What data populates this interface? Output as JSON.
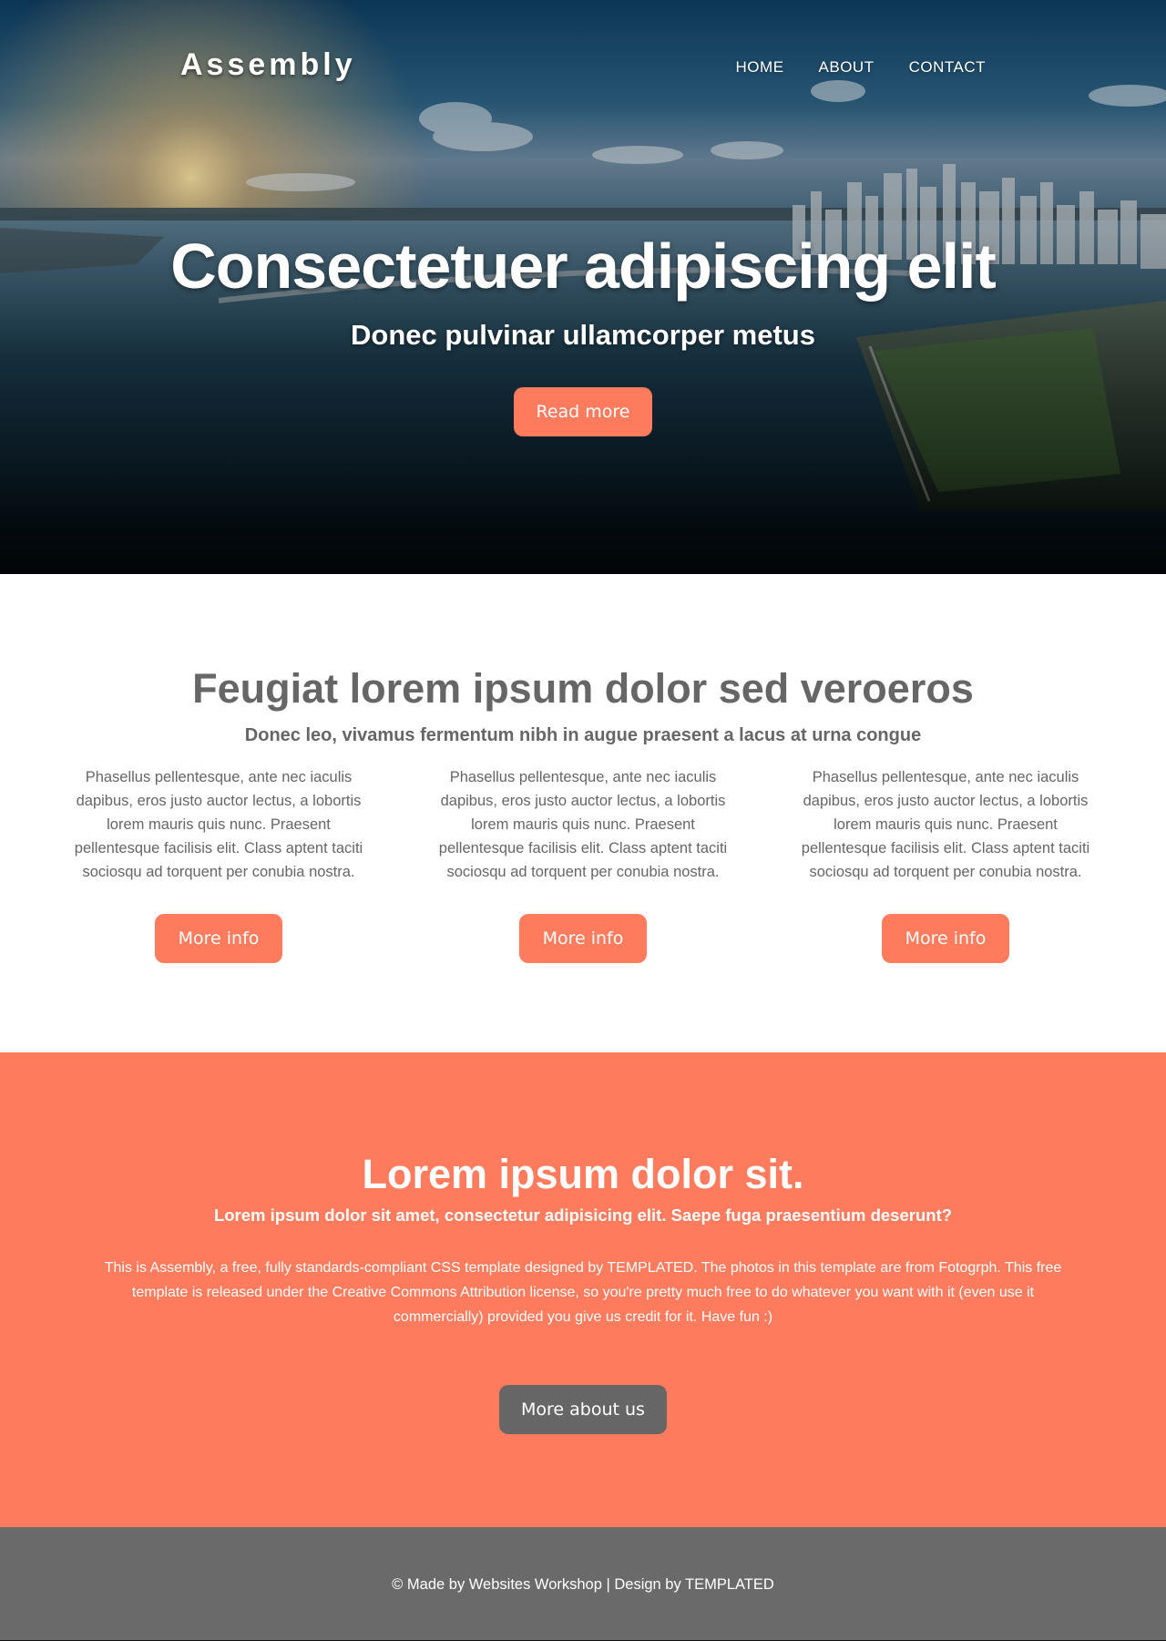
{
  "header": {
    "logo": "Assembly",
    "nav": [
      {
        "label": "HOME"
      },
      {
        "label": "ABOUT"
      },
      {
        "label": "CONTACT"
      }
    ]
  },
  "hero": {
    "title": "Consectetuer adipiscing elit",
    "subtitle": "Donec pulvinar ullamcorper metus",
    "button": "Read more"
  },
  "features": {
    "title": "Feugiat lorem ipsum dolor sed veroeros",
    "subtitle": "Donec leo, vivamus fermentum nibh in augue praesent a lacus at urna congue",
    "columns": [
      {
        "text": "Phasellus pellentesque, ante nec iaculis dapibus, eros justo auctor lectus, a lobortis lorem mauris quis nunc. Praesent pellentesque facilisis elit. Class aptent taciti sociosqu ad torquent per conubia nostra.",
        "button": "More info"
      },
      {
        "text": "Phasellus pellentesque, ante nec iaculis dapibus, eros justo auctor lectus, a lobortis lorem mauris quis nunc. Praesent pellentesque facilisis elit. Class aptent taciti sociosqu ad torquent per conubia nostra.",
        "button": "More info"
      },
      {
        "text": "Phasellus pellentesque, ante nec iaculis dapibus, eros justo auctor lectus, a lobortis lorem mauris quis nunc. Praesent pellentesque facilisis elit. Class aptent taciti sociosqu ad torquent per conubia nostra.",
        "button": "More info"
      }
    ]
  },
  "about": {
    "title": "Lorem ipsum dolor sit.",
    "subtitle": "Lorem ipsum dolor sit amet, consectetur adipisicing elit. Saepe fuga praesentium deserunt?",
    "text": "This is Assembly, a free, fully standards-compliant CSS template designed by TEMPLATED. The photos in this template are from Fotogrph. This free template is released under the Creative Commons Attribution license, so you're pretty much free to do whatever you want with it (even use it commercially) provided you give us credit for it. Have fun :)",
    "button": "More about us"
  },
  "footer": {
    "text": "© Made by Websites Workshop | Design by TEMPLATED"
  },
  "colors": {
    "accent": "#ff7b5d",
    "gray": "#666666",
    "footer": "#6a6a6a"
  }
}
